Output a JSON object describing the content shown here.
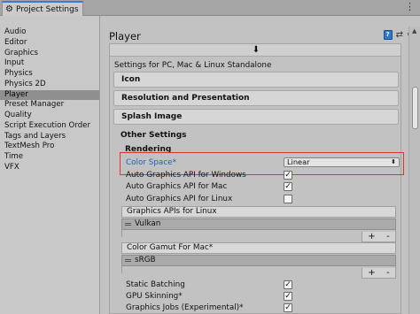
{
  "window": {
    "tab_title": "Project Settings",
    "tab_icon": "gear-icon",
    "menu_icon": "kebab-menu-icon"
  },
  "sidebar": {
    "items": [
      {
        "label": "Audio"
      },
      {
        "label": "Editor"
      },
      {
        "label": "Graphics"
      },
      {
        "label": "Input"
      },
      {
        "label": "Physics"
      },
      {
        "label": "Physics 2D"
      },
      {
        "label": "Player",
        "selected": true
      },
      {
        "label": "Preset Manager"
      },
      {
        "label": "Quality"
      },
      {
        "label": "Script Execution Order"
      },
      {
        "label": "Tags and Layers"
      },
      {
        "label": "TextMesh Pro"
      },
      {
        "label": "Time"
      },
      {
        "label": "VFX"
      }
    ]
  },
  "main": {
    "title": "Player",
    "header_icons": [
      "help-book-icon",
      "preset-icon",
      "settings-gear-icon"
    ],
    "platform_text": "Settings for PC, Mac & Linux Standalone",
    "platform_icon": "download-arrow-icon",
    "sections": [
      {
        "label": "Icon"
      },
      {
        "label": "Resolution and Presentation"
      },
      {
        "label": "Splash Image"
      }
    ],
    "other_settings": {
      "title": "Other Settings",
      "rendering_label": "Rendering",
      "color_space": {
        "label": "Color Space*",
        "value": "Linear"
      },
      "toggles": [
        {
          "label": "Auto Graphics API  for Windows",
          "checked": true
        },
        {
          "label": "Auto Graphics API  for Mac",
          "checked": true
        },
        {
          "label": "Auto Graphics API  for Linux",
          "checked": false
        }
      ],
      "graphics_apis_linux": {
        "header": "Graphics APIs for Linux",
        "item": "Vulkan"
      },
      "color_gamut_mac": {
        "header": "Color Gamut For Mac*",
        "item": "sRGB"
      },
      "toggles2": [
        {
          "label": "Static Batching",
          "checked": true
        },
        {
          "label": "GPU Skinning*",
          "checked": true
        },
        {
          "label": "Graphics Jobs (Experimental)*",
          "checked": true
        }
      ],
      "list_add": "+",
      "list_remove": "-"
    }
  },
  "colors": {
    "accent_blue": "#1f5ec8",
    "highlight_red": "#e33030",
    "selected_bg": "#8f8f8f"
  }
}
